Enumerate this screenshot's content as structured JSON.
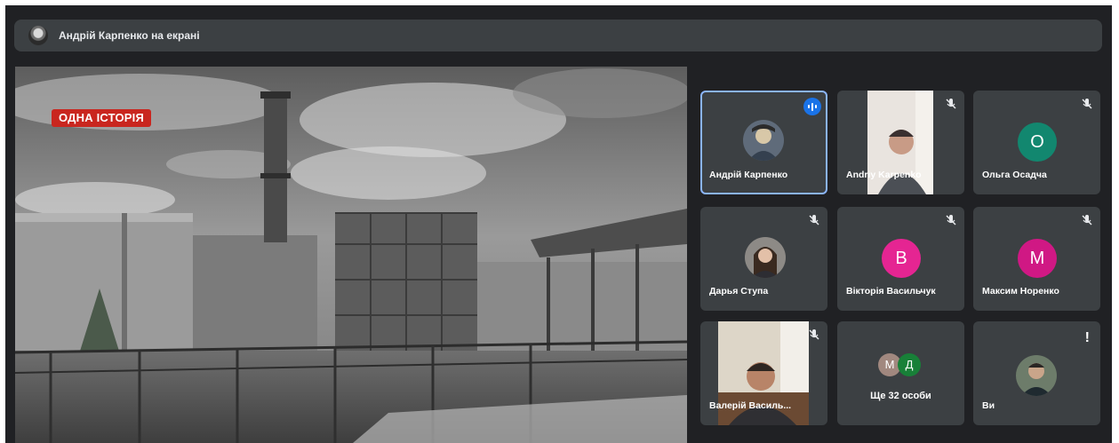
{
  "banner": {
    "text": "Андрій Карпенко на екрані",
    "avatar_icon": "presenter-avatar"
  },
  "presentation": {
    "badge": "ОДНА ІСТОРІЯ",
    "badge_color": "#c9261f"
  },
  "participants": [
    {
      "name": "Андрій Карпенко",
      "type": "photo",
      "status": "speaking",
      "active": true
    },
    {
      "name": "Andriy Karpenko",
      "type": "video",
      "status": "muted"
    },
    {
      "name": "Ольга Осадча",
      "type": "letter",
      "letter": "О",
      "color": "#12876f",
      "status": "muted"
    },
    {
      "name": "Дарья Ступа",
      "type": "photo",
      "status": "muted"
    },
    {
      "name": "Вікторія Васильчук",
      "type": "letter",
      "letter": "В",
      "color": "#e52592",
      "status": "muted"
    },
    {
      "name": "Максим Норенко",
      "type": "letter",
      "letter": "М",
      "color": "#d01884",
      "status": "muted"
    },
    {
      "name": "Валерій Василь...",
      "type": "video",
      "status": "muted"
    },
    {
      "name": "Ще 32 особи",
      "type": "more",
      "letters": [
        "М",
        "Д"
      ],
      "colors": [
        "#a1887f",
        "#188038"
      ]
    },
    {
      "name": "Ви",
      "type": "photo",
      "status": "alert"
    }
  ],
  "colors": {
    "background": "#202124",
    "tile": "#3c4043",
    "active_border": "#8ab4f8",
    "speaking": "#1a73e8"
  }
}
